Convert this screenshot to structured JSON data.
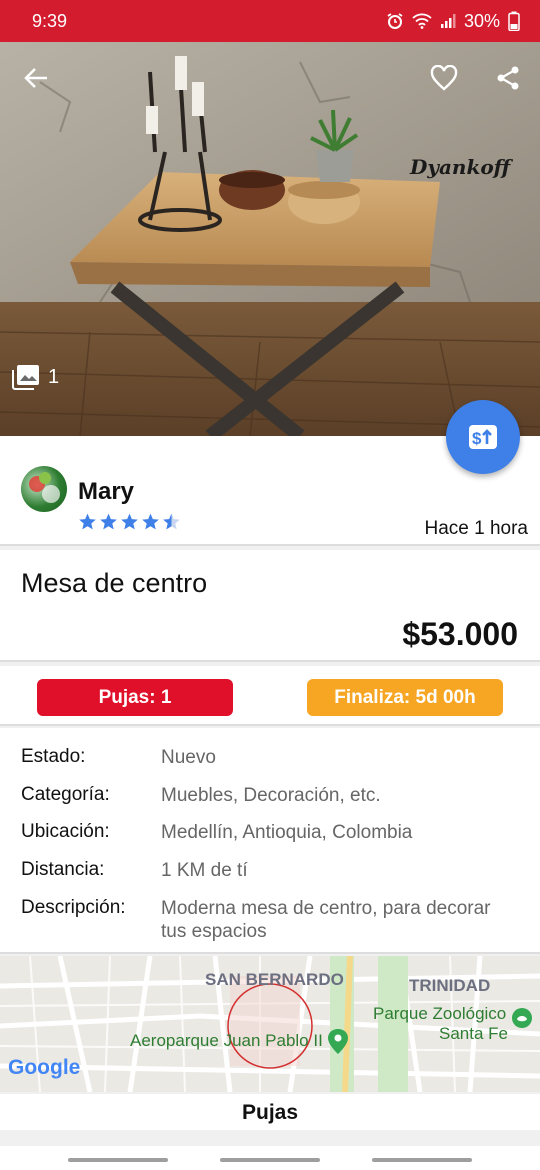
{
  "status_bar": {
    "time": "9:39",
    "battery": "30%",
    "icons": [
      "alarm-icon",
      "wifi-icon",
      "signal-icon",
      "battery-icon"
    ]
  },
  "hero": {
    "watermark": "Dyankoff",
    "photo_count": "1",
    "icons": [
      "back-arrow-icon",
      "heart-icon",
      "share-icon",
      "gallery-icon"
    ]
  },
  "fab": {
    "label": "$↑",
    "icon": "bid-dollar-icon",
    "color": "#3f7fe8"
  },
  "seller": {
    "name": "Mary",
    "rating": 4.5,
    "rating_max": 5,
    "posted": "Hace 1 hora"
  },
  "listing": {
    "title": "Mesa de centro",
    "price": "$53.000"
  },
  "badges": {
    "bids": "Pujas: 1",
    "ends": "Finaliza: 5d 00h",
    "bids_color": "#e0102a",
    "ends_color": "#f6a623"
  },
  "details": {
    "rows": [
      {
        "label": "Estado:",
        "value": "Nuevo"
      },
      {
        "label": "Categoría:",
        "value": "Muebles, Decoración, etc."
      },
      {
        "label": "Ubicación:",
        "value": "Medellín, Antioquia, Colombia"
      },
      {
        "label": "Distancia:",
        "value": "1 KM de tí"
      },
      {
        "label": "Descripción:",
        "value": "Moderna mesa de centro, para decorar tus espacios"
      }
    ]
  },
  "map": {
    "labels": {
      "san_bernardo": "SAN BERNARDO",
      "trinidad": "TRINIDAD",
      "zoo_line1": "Parque Zoológico",
      "zoo_line2": "Santa Fe",
      "aeroparque": "Aeroparque Juan Pablo II",
      "google": "Google"
    }
  },
  "bids_section": {
    "title": "Pujas"
  },
  "colors": {
    "accent_red": "#d31d2e",
    "accent_blue": "#3f7fe8"
  }
}
